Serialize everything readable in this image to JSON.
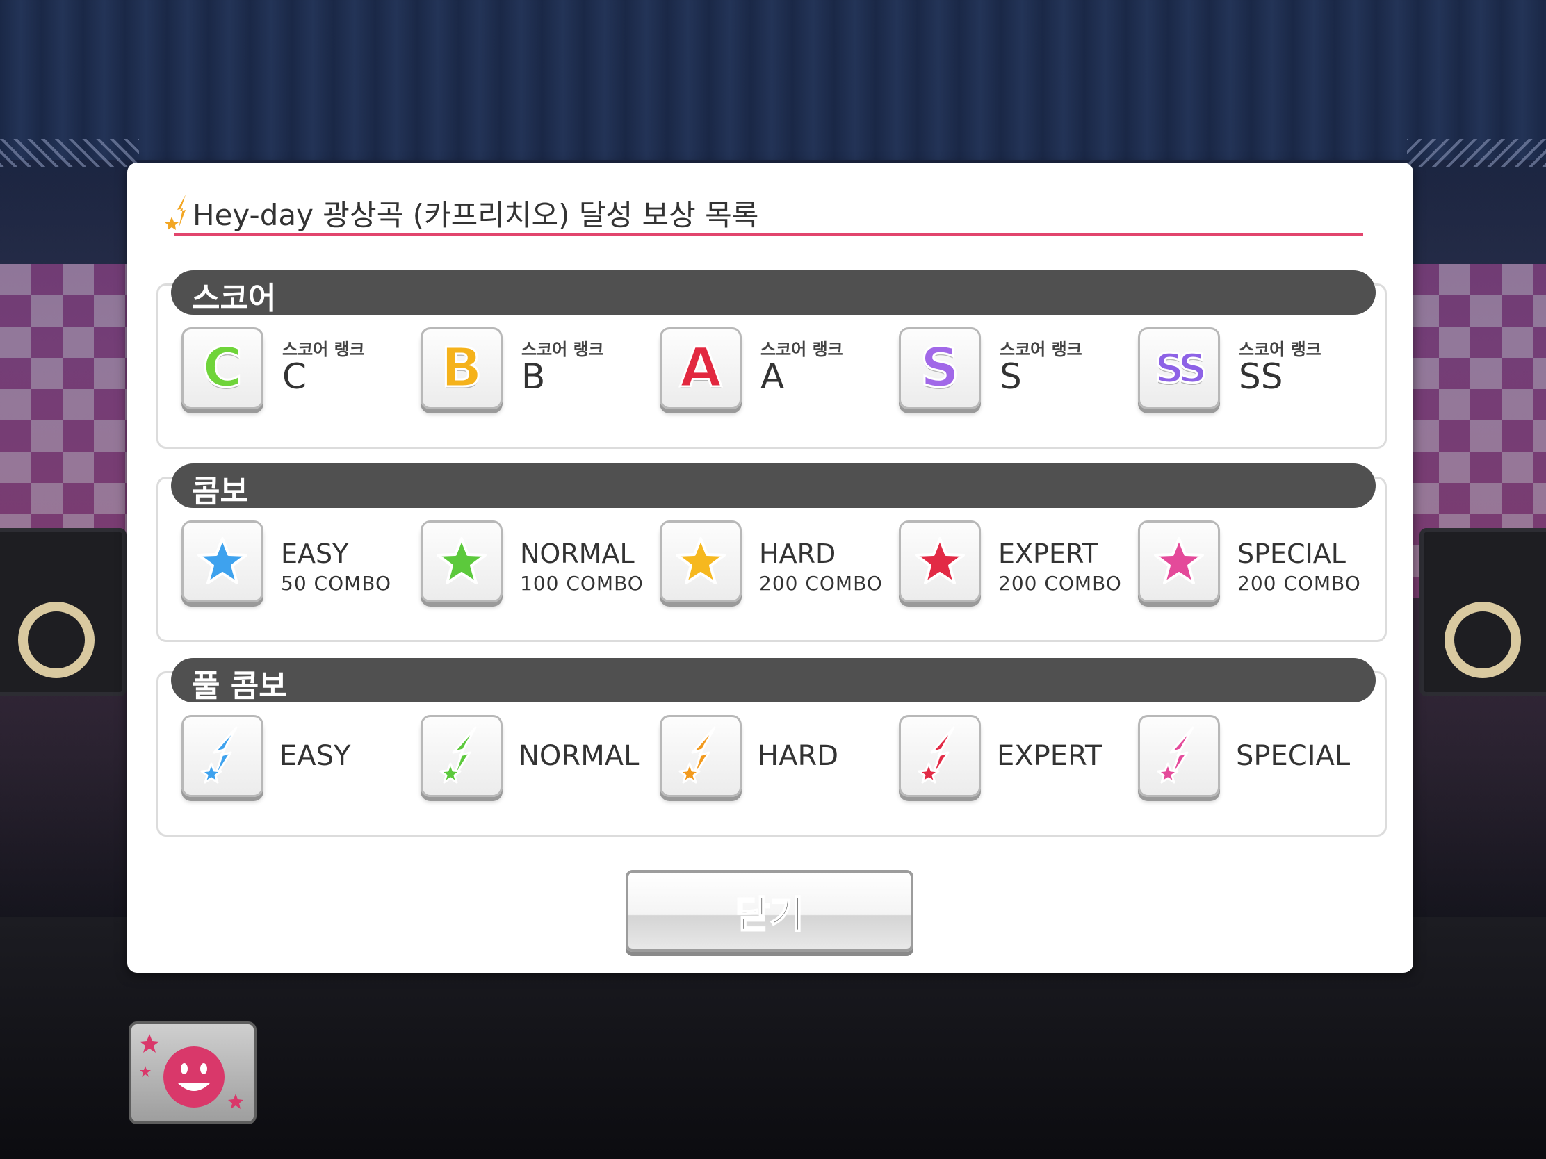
{
  "dialog": {
    "title": "Hey-day 광상곡 (카프리치오) 달성 보상 목록",
    "accent_color": "#e2456d"
  },
  "sections": [
    {
      "header": "스코어",
      "items": [
        {
          "icon": "rank-c-icon",
          "letter": "C",
          "color": "#6fd43a",
          "sub": "스코어 랭크",
          "label": "C"
        },
        {
          "icon": "rank-b-icon",
          "letter": "B",
          "color": "#f5b21b",
          "sub": "스코어 랭크",
          "label": "B"
        },
        {
          "icon": "rank-a-icon",
          "letter": "A",
          "color": "#e2283f",
          "sub": "스코어 랭크",
          "label": "A"
        },
        {
          "icon": "rank-s-icon",
          "letter": "S",
          "color": "#a168e8",
          "sub": "스코어 랭크",
          "label": "S"
        },
        {
          "icon": "rank-ss-icon",
          "letter": "SS",
          "color": "#8d62e6",
          "sub": "스코어 랭크",
          "label": "SS"
        }
      ]
    },
    {
      "header": "콤보",
      "items": [
        {
          "icon": "blue-star-icon",
          "color": "#3ea2ee",
          "label": "EASY",
          "count": "50  COMBO"
        },
        {
          "icon": "green-star-icon",
          "color": "#5cc93c",
          "label": "NORMAL",
          "count": "100  COMBO"
        },
        {
          "icon": "yellow-star-icon",
          "color": "#f6b81f",
          "label": "HARD",
          "count": "200  COMBO"
        },
        {
          "icon": "red-star-icon",
          "color": "#e22a45",
          "label": "EXPERT",
          "count": "200  COMBO"
        },
        {
          "icon": "pink-star-icon",
          "color": "#e44a9a",
          "label": "SPECIAL",
          "count": "200  COMBO"
        }
      ]
    },
    {
      "header": "풀 콤보",
      "items": [
        {
          "icon": "blue-shooting-star-icon",
          "color": "#3ea2ee",
          "label": "EASY"
        },
        {
          "icon": "green-shooting-star-icon",
          "color": "#5cc93c",
          "label": "NORMAL"
        },
        {
          "icon": "orange-shooting-star-icon",
          "color": "#f29a1e",
          "label": "HARD"
        },
        {
          "icon": "red-shooting-star-icon",
          "color": "#e22a45",
          "label": "EXPERT"
        },
        {
          "icon": "pink-shooting-star-icon",
          "color": "#e44a9a",
          "label": "SPECIAL"
        }
      ]
    }
  ],
  "close_button": {
    "label": "닫기"
  },
  "mascot_button": {
    "icon": "smiley-mascot-icon",
    "color": "#d9386a"
  }
}
